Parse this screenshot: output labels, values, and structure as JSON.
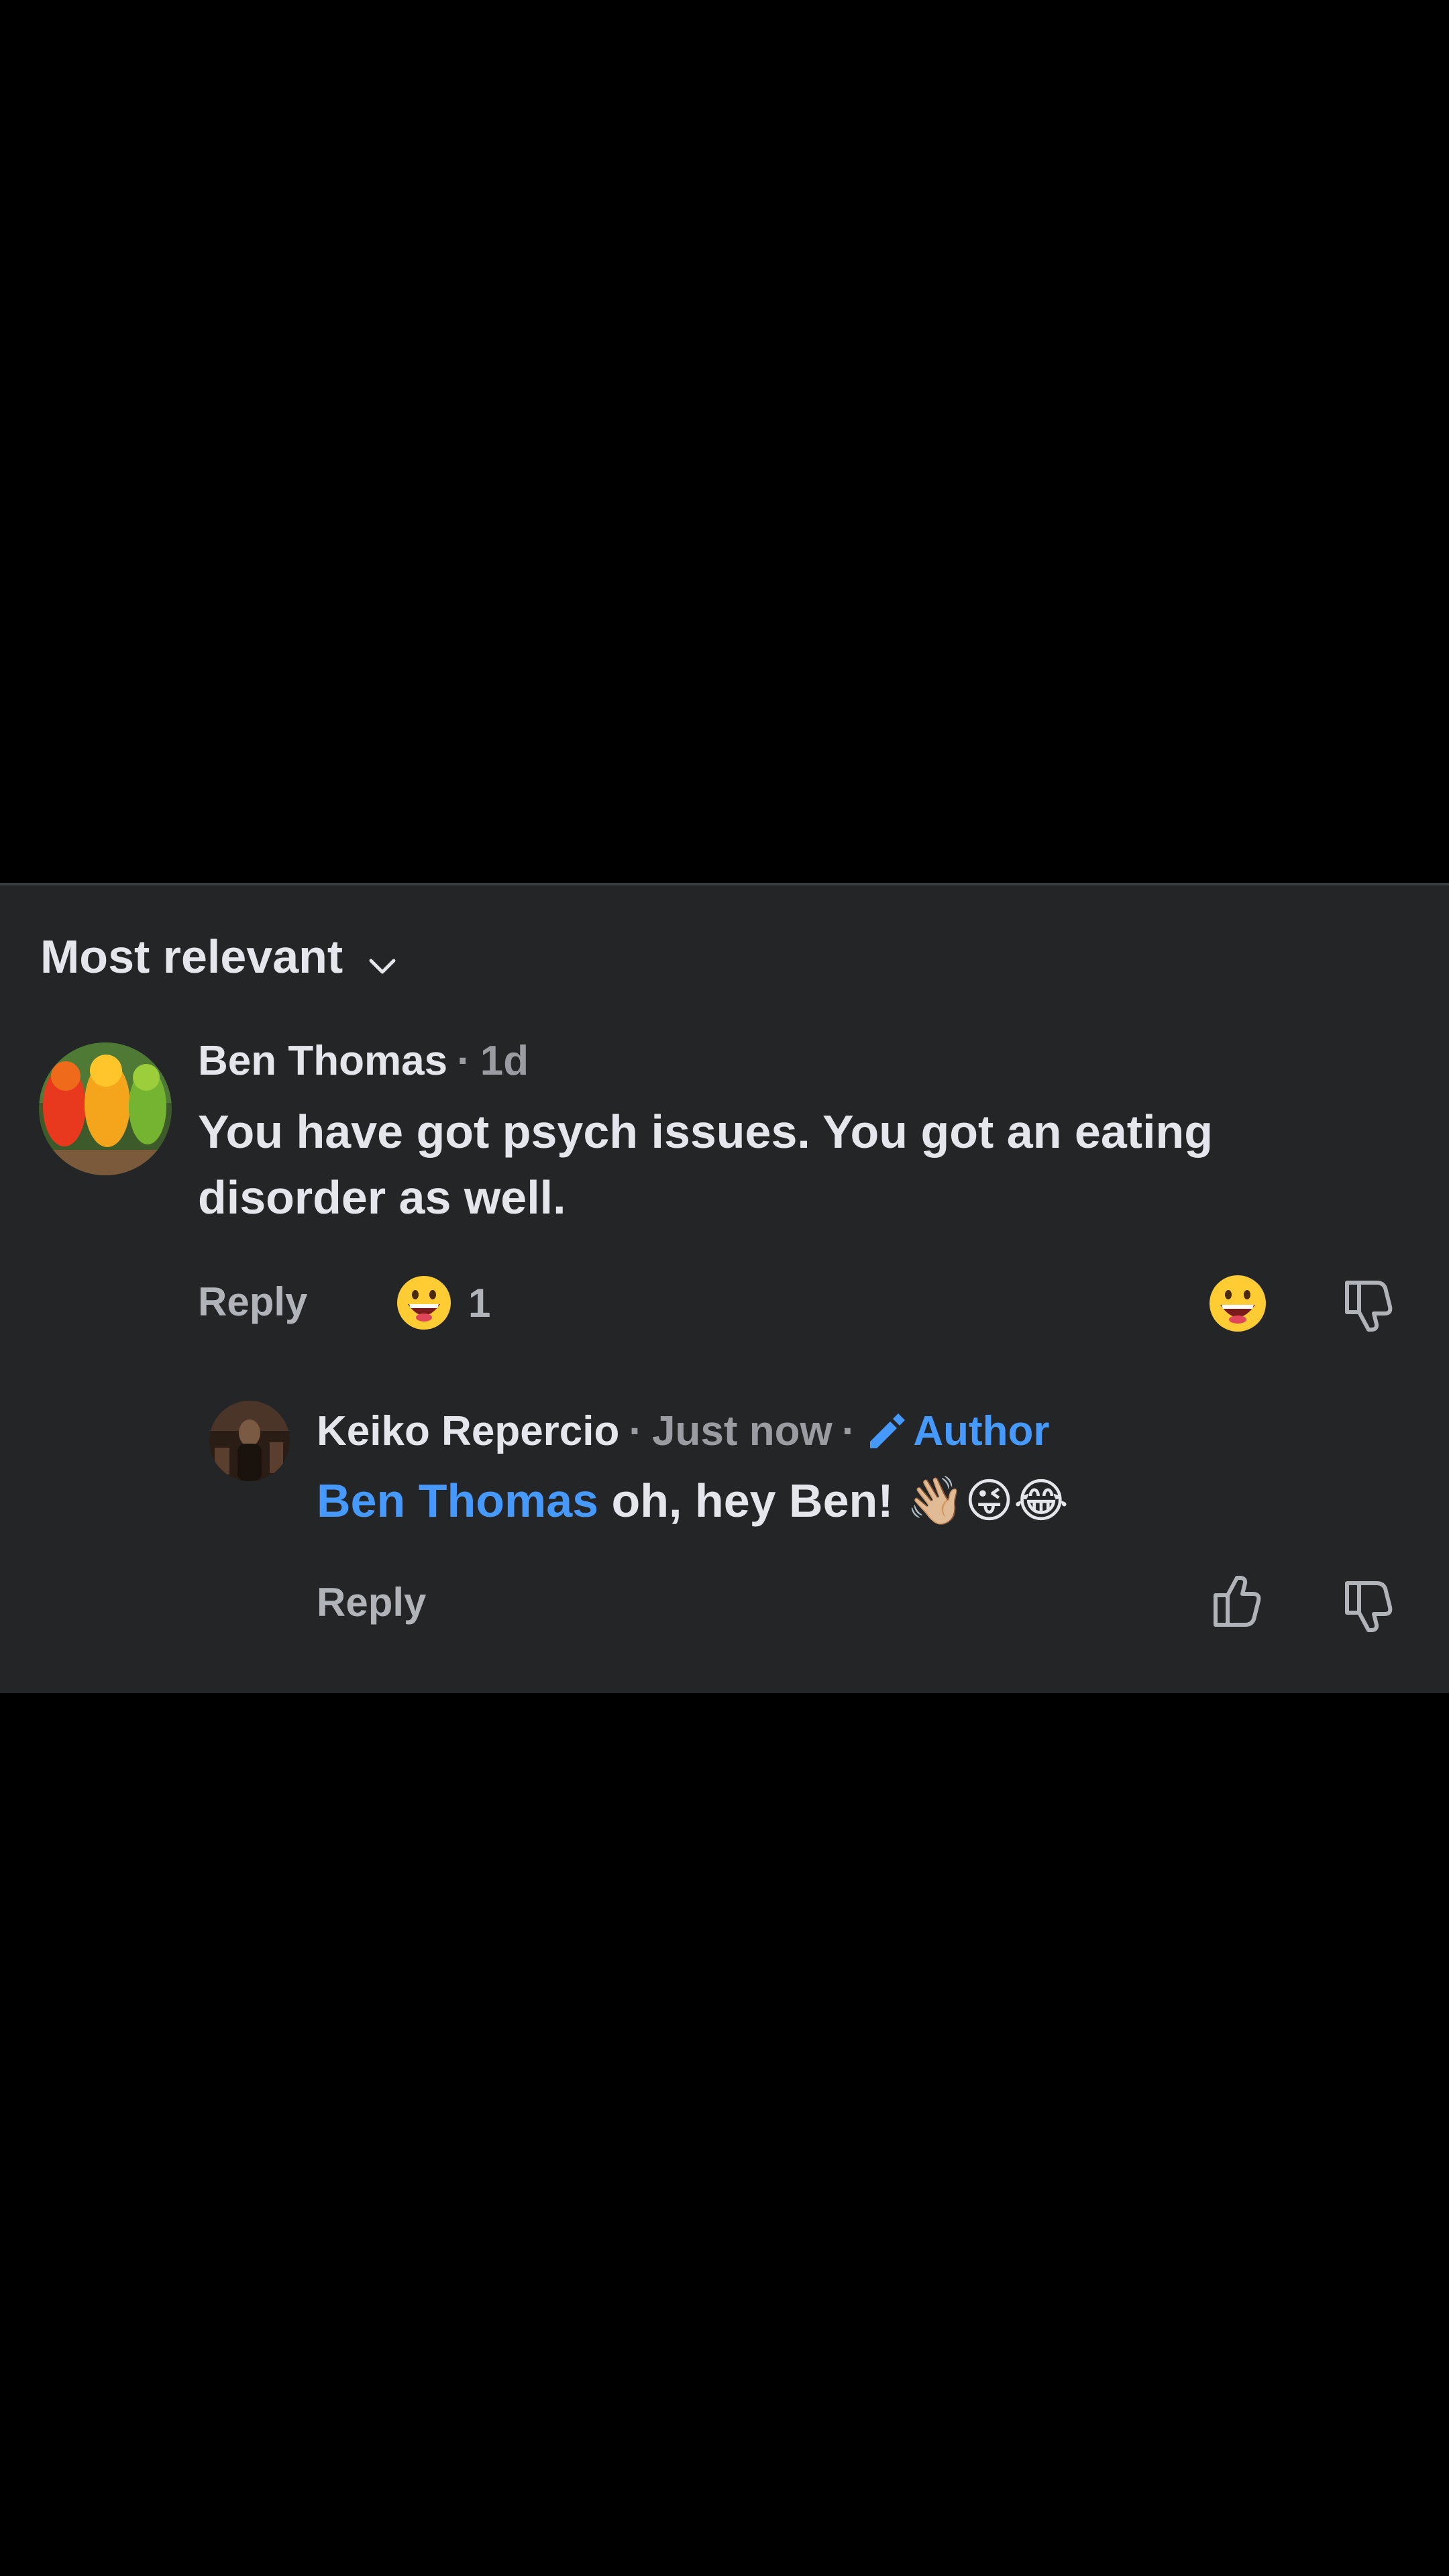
{
  "sort": {
    "label": "Most relevant",
    "icon": "chevron-down-icon"
  },
  "comments": [
    {
      "author": "Ben Thomas",
      "time": "1d",
      "text": "You have got psych issues. You got an eating disorder as well.",
      "reply_label": "Reply",
      "reaction_count": "1",
      "reaction_icon": "grinning-face-emoji"
    },
    {
      "author": "Keiko Repercio",
      "time": "Just now",
      "badge": "Author",
      "mention": "Ben Thomas",
      "text": "oh, hey Ben! 👋🏼😜😂",
      "reply_label": "Reply"
    }
  ],
  "colors": {
    "panel": "#242526",
    "accent": "#4599ff",
    "muted": "#9a9ca1"
  }
}
